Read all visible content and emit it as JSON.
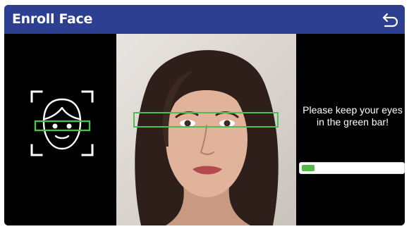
{
  "header": {
    "title": "Enroll Face",
    "back_icon": "back-arrow-icon",
    "color": "#2d3f91"
  },
  "left_panel": {
    "icon": "face-scan-icon",
    "guide_color": "#4fbd4f"
  },
  "camera": {
    "guide_color": "#4fbd4f"
  },
  "right_panel": {
    "instruction": "Please keep your eyes in the green bar!"
  },
  "progress": {
    "fraction": 0.13,
    "fill_color": "#57b84a"
  }
}
